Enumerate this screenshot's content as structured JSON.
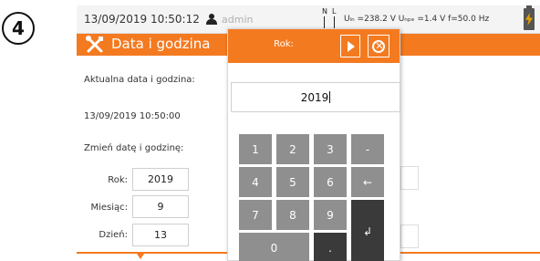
{
  "step_number": "4",
  "status_bar": {
    "datetime": "13/09/2019 10:50:12",
    "user": "admin",
    "voltages": "Uₗₙ =238.2 V Uₙₚₑ =1.4 V f=50.0 Hz",
    "nl_labels": {
      "n": "N",
      "l": "L"
    },
    "icons": [
      "user-icon",
      "nl-connection-icon",
      "battery-charging-icon"
    ]
  },
  "title_bar": {
    "icon": "tools-icon",
    "title": "Data i godzina",
    "accent_color": "#f47a20"
  },
  "content": {
    "current_label": "Aktualna data i godzina:",
    "current_value": "13/09/2019 10:50:00",
    "change_label": "Zmień datę i godzinę:",
    "fields": [
      {
        "label": "Rok:",
        "value": "2019"
      },
      {
        "label": "Miesiąc:",
        "value": "9"
      },
      {
        "label": "Dzień:",
        "value": "13"
      }
    ]
  },
  "keypad_popup": {
    "title": "Rok:",
    "value": "2019",
    "keys": {
      "k1": "1",
      "k2": "2",
      "k3": "3",
      "minus": "-",
      "k4": "4",
      "k5": "5",
      "k6": "6",
      "backspace": "←",
      "k7": "7",
      "k8": "8",
      "k9": "9",
      "enter": "↲",
      "k0": "0",
      "dot": "."
    },
    "icons": [
      "play-icon",
      "close-icon"
    ]
  }
}
